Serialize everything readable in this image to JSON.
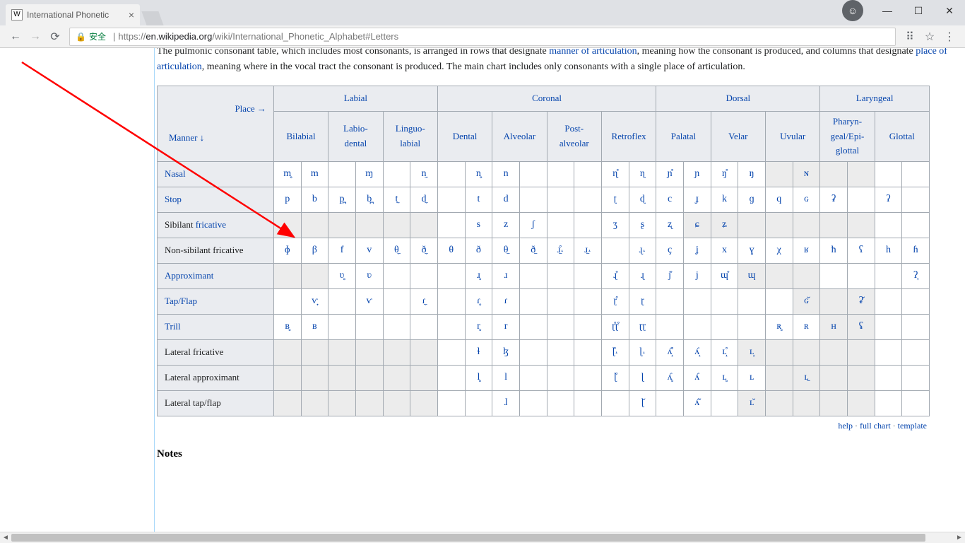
{
  "browser": {
    "tab_title": "International Phonetic",
    "favicon_letter": "W",
    "secure_label": "安全",
    "url_scheme": "https://",
    "url_host": "en.wikipedia.org",
    "url_path": "/wiki/International_Phonetic_Alphabet#Letters",
    "user_glyph": "☺"
  },
  "intro": {
    "p1a": "The pulmonic consonant table, which includes most consonants, is arranged in rows that designate ",
    "p1_link1": "manner of articulation",
    "p1b": ", meaning how the consonant is produced, and columns that designate ",
    "p1_link2": "place of articulation",
    "p1c": ", meaning where in the vocal tract the consonant is produced. The main chart includes only consonants with a single place of articulation."
  },
  "table": {
    "place_label": "Place →",
    "manner_label": "Manner ↓",
    "groups": [
      "Labial",
      "Coronal",
      "Dorsal",
      "Laryngeal"
    ],
    "cols": [
      "Bilabial",
      "Labio-dental",
      "Linguo-labial",
      "Dental",
      "Alveolar",
      "Post-alveolar",
      "Retroflex",
      "Palatal",
      "Velar",
      "Uvular",
      "Pharyn-geal/Epi-glottal",
      "Glottal"
    ],
    "rows": [
      {
        "head": "Nasal",
        "is_link": true,
        "cells": [
          "m̥",
          "m",
          "",
          "ɱ",
          "",
          "n̼",
          "",
          "n̥",
          "n",
          "",
          "ɳ̊",
          "ɳ",
          "ɲ̊",
          "ɲ",
          "ŋ̊",
          "ŋ",
          "",
          "ɴ",
          "",
          "",
          "",
          ""
        ]
      },
      {
        "head": "Stop",
        "is_link": true,
        "cells": [
          "p",
          "b",
          "p̪",
          "b̪",
          "t̼",
          "d̼",
          "",
          "t",
          "d",
          "",
          "ʈ",
          "ɖ",
          "c",
          "ɟ",
          "k",
          "ɡ",
          "q",
          "ɢ",
          "ʡ",
          "",
          "ʔ",
          ""
        ]
      },
      {
        "head_plain": "Sibilant ",
        "head_link": "fricative",
        "cells": [
          "",
          "",
          "",
          "",
          "",
          "",
          "",
          "s",
          "z",
          "ʃ",
          "ʒ",
          "ʂ",
          "ʐ",
          "ɕ",
          "ʑ",
          "",
          "",
          "",
          "",
          "",
          "",
          ""
        ]
      },
      {
        "head": "Non-sibilant fricative",
        "is_link": false,
        "cells": [
          "ɸ",
          "β",
          "f",
          "v",
          "θ̼",
          "ð̼",
          "θ",
          "ð",
          "θ̠",
          "ð̠",
          "ɹ̠̊˔",
          "ɹ̠˔",
          "",
          "ɻ˔",
          "ç",
          "ʝ",
          "x",
          "ɣ",
          "χ",
          "ʁ",
          "ħ",
          "ʕ",
          "h",
          "ɦ"
        ],
        "wide": true
      },
      {
        "head": "Approximant",
        "is_link": true,
        "cells": [
          "",
          "",
          "ʋ̥",
          "ʋ",
          "",
          "",
          "",
          "ɹ̥",
          "ɹ",
          "",
          "ɻ̊",
          "ɻ",
          "j̊",
          "j",
          "ɰ̊",
          "ɰ",
          "",
          "",
          "",
          "",
          "",
          "ʔ̞"
        ]
      },
      {
        "head": "Tap/Flap",
        "is_link": true,
        "cells": [
          "",
          "ⱱ̟",
          "",
          "ⱱ",
          "",
          "ɾ̼",
          "",
          "ɾ̥",
          "ɾ",
          "",
          "ɽ̊",
          "ɽ",
          "",
          "",
          "",
          "",
          "",
          "ɢ̆",
          "",
          "ʡ̆",
          "",
          ""
        ]
      },
      {
        "head": "Trill",
        "is_link": true,
        "cells": [
          "ʙ̥",
          "ʙ",
          "",
          "",
          "",
          "",
          "",
          "r̥",
          "r",
          "",
          "ɽ̊ɽ̊",
          "ɽɽ",
          "",
          "",
          "",
          "",
          "ʀ̥",
          "ʀ",
          "ʜ",
          "ʢ",
          "",
          ""
        ]
      },
      {
        "head": "Lateral fricative",
        "is_link": false,
        "cells": [
          "",
          "",
          "",
          "",
          "",
          "",
          "",
          "ɬ",
          "ɮ",
          "",
          "ɭ̊˔",
          "ɭ˔",
          "ʎ̝̊",
          "ʎ̝",
          "ʟ̝̊",
          "ʟ̝",
          "",
          "",
          "",
          "",
          "",
          ""
        ]
      },
      {
        "head": "Lateral approximant",
        "is_link": false,
        "cells": [
          "",
          "",
          "",
          "",
          "",
          "",
          "",
          "l̥",
          "l",
          "",
          "ɭ̊",
          "ɭ",
          "ʎ̥",
          "ʎ",
          "ʟ̥",
          "ʟ",
          "",
          "ʟ̠",
          "",
          "",
          "",
          ""
        ]
      },
      {
        "head": "Lateral tap/flap",
        "is_link": false,
        "cells": [
          "",
          "",
          "",
          "",
          "",
          "",
          "",
          "",
          "ɺ",
          "",
          "",
          "ɭ̆",
          "",
          "ʎ̆",
          "",
          "ʟ̆",
          "",
          "",
          "",
          "",
          "",
          ""
        ]
      }
    ],
    "shaded_ranges": {
      "Sibilant fricative": [
        0,
        1,
        2,
        3,
        4,
        5,
        15,
        16,
        17,
        18,
        19,
        20,
        21
      ],
      "Approximant": [
        0,
        1,
        17,
        18,
        19
      ],
      "Tap/Flap": [
        19,
        20,
        21
      ],
      "Trill": [
        20,
        21
      ],
      "Lateral fricative": [
        0,
        1,
        2,
        3,
        4,
        5,
        17,
        18,
        19,
        20,
        21
      ],
      "Lateral approximant": [
        0,
        1,
        2,
        3,
        4,
        5,
        18,
        19,
        20,
        21
      ],
      "Lateral tap/flap": [
        0,
        1,
        2,
        3,
        4,
        5,
        17,
        18,
        19,
        20,
        21
      ],
      "Nasal": [
        18,
        19,
        20,
        21
      ],
      "Non-sibilant fricative": []
    }
  },
  "footer": {
    "help": "help",
    "full": "full chart",
    "template": "template"
  },
  "notes": "Notes"
}
